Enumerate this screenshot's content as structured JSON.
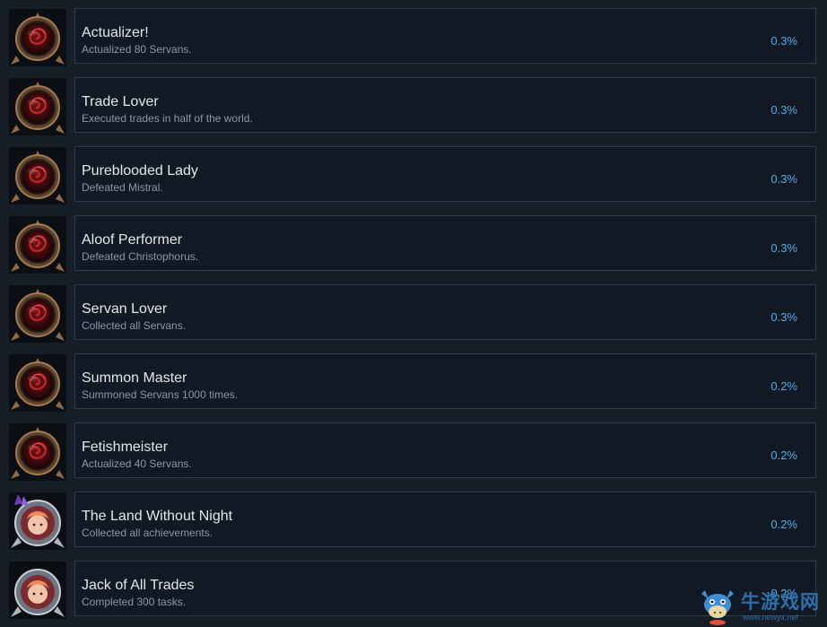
{
  "achievements": [
    {
      "title": "Actualizer!",
      "description": "Actualized 80 Servans.",
      "percent": "0.3%",
      "icon": "rose-emblem-icon"
    },
    {
      "title": "Trade Lover",
      "description": "Executed trades in half of the world.",
      "percent": "0.3%",
      "icon": "rose-emblem-icon"
    },
    {
      "title": "Pureblooded Lady",
      "description": "Defeated Mistral.",
      "percent": "0.3%",
      "icon": "rose-emblem-icon"
    },
    {
      "title": "Aloof Performer",
      "description": "Defeated Christophorus.",
      "percent": "0.3%",
      "icon": "rose-emblem-icon"
    },
    {
      "title": "Servan Lover",
      "description": "Collected all Servans.",
      "percent": "0.3%",
      "icon": "rose-emblem-icon"
    },
    {
      "title": "Summon Master",
      "description": "Summoned Servans 1000 times.",
      "percent": "0.2%",
      "icon": "rose-emblem-icon"
    },
    {
      "title": "Fetishmeister",
      "description": "Actualized 40 Servans.",
      "percent": "0.2%",
      "icon": "rose-emblem-icon"
    },
    {
      "title": "The Land Without Night",
      "description": "Collected all achievements.",
      "percent": "0.2%",
      "icon": "portrait-emblem-icon"
    },
    {
      "title": "Jack of All Trades",
      "description": "Completed 300 tasks.",
      "percent": "0.2%",
      "icon": "portrait-emblem-icon"
    }
  ],
  "watermark": {
    "text": "牛游戏网",
    "url": "www.newyx.net",
    "icon": "bull-mascot-icon"
  },
  "colors": {
    "background": "#161e27",
    "panel": "#111a24",
    "panel_border": "#2b3e50",
    "percent": "#5aa9e6",
    "title": "#e3e7eb",
    "description": "#8b97a3"
  }
}
